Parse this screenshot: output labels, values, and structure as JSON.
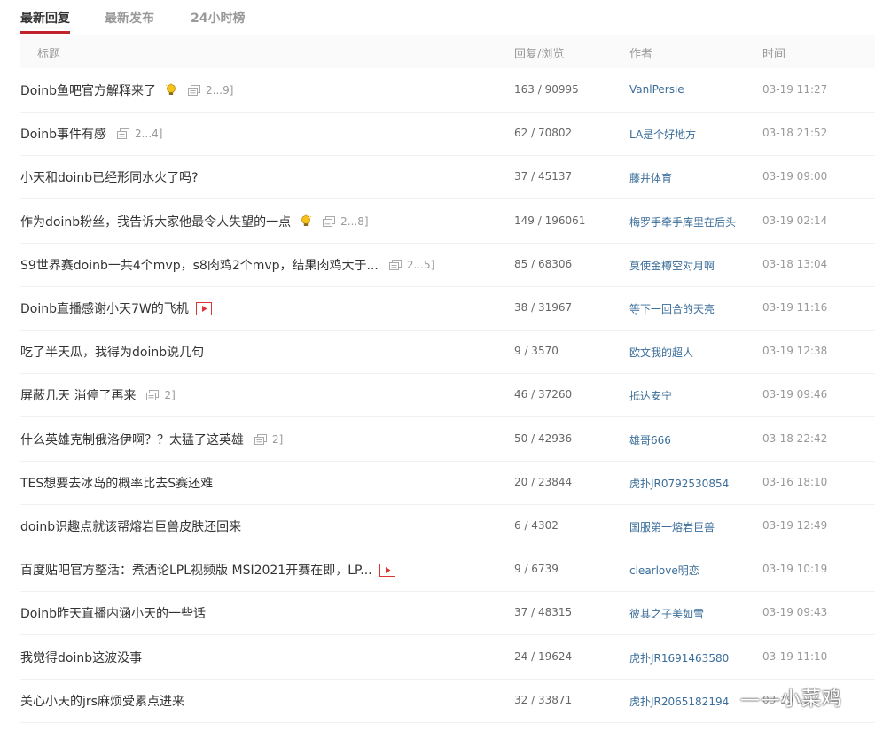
{
  "tabs": [
    {
      "label": "最新回复",
      "active": true
    },
    {
      "label": "最新发布",
      "active": false
    },
    {
      "label": "24小时榜",
      "active": false
    }
  ],
  "accent_color": "#c0232a",
  "author_color": "#3a6d99",
  "columns": {
    "title": "标题",
    "stats": "回复/浏览",
    "author": "作者",
    "time": "时间"
  },
  "rows": [
    {
      "title": "Doinb鱼吧官方解释来了",
      "lightbulb": true,
      "pages": "2...9]",
      "video": false,
      "stats": "163 / 90995",
      "author": "VanlPersie",
      "time": "03-19 11:27"
    },
    {
      "title": "Doinb事件有感",
      "lightbulb": false,
      "pages": "2...4]",
      "video": false,
      "stats": "62 / 70802",
      "author": "LA是个好地方",
      "time": "03-18 21:52"
    },
    {
      "title": "小天和doinb已经形同水火了吗?",
      "lightbulb": false,
      "pages": "",
      "video": false,
      "stats": "37 / 45137",
      "author": "藤井体育",
      "time": "03-19 09:00"
    },
    {
      "title": "作为doinb粉丝，我告诉大家他最令人失望的一点",
      "lightbulb": true,
      "pages": "2...8]",
      "video": false,
      "stats": "149 / 196061",
      "author": "梅罗手牵手库里在后头",
      "time": "03-19 02:14"
    },
    {
      "title": "S9世界赛doinb一共4个mvp，s8肉鸡2个mvp，结果肉鸡大于...",
      "lightbulb": false,
      "pages": "2...5]",
      "video": false,
      "stats": "85 / 68306",
      "author": "莫使金樽空对月啊",
      "time": "03-18 13:04"
    },
    {
      "title": "Doinb直播感谢小天7W的飞机",
      "lightbulb": false,
      "pages": "",
      "video": true,
      "stats": "38 / 31967",
      "author": "等下一回合的天亮",
      "time": "03-19 11:16"
    },
    {
      "title": "吃了半天瓜，我得为doinb说几句",
      "lightbulb": false,
      "pages": "",
      "video": false,
      "stats": "9 / 3570",
      "author": "欧文我的超人",
      "time": "03-19 12:38"
    },
    {
      "title": "屏蔽几天 消停了再来",
      "lightbulb": false,
      "pages": "2]",
      "video": false,
      "stats": "46 / 37260",
      "author": "抵达安宁",
      "time": "03-19 09:46"
    },
    {
      "title": "什么英雄克制俄洛伊啊？？太猛了这英雄",
      "lightbulb": false,
      "pages": "2]",
      "video": false,
      "stats": "50 / 42936",
      "author": "雄哥666",
      "time": "03-18 22:42"
    },
    {
      "title": "TES想要去冰岛的概率比去S赛还难",
      "lightbulb": false,
      "pages": "",
      "video": false,
      "stats": "20 / 23844",
      "author": "虎扑JR0792530854",
      "time": "03-16 18:10"
    },
    {
      "title": "doinb识趣点就该帮熔岩巨兽皮肤还回来",
      "lightbulb": false,
      "pages": "",
      "video": false,
      "stats": "6 / 4302",
      "author": "国服第一熔岩巨兽",
      "time": "03-19 12:49"
    },
    {
      "title": "百度贴吧官方整活：煮酒论LPL视频版 MSI2021开赛在即，LP...",
      "lightbulb": false,
      "pages": "",
      "video": true,
      "stats": "9 / 6739",
      "author": "clearlove明恋",
      "time": "03-19 10:19"
    },
    {
      "title": "Doinb昨天直播内涵小天的一些话",
      "lightbulb": false,
      "pages": "",
      "video": false,
      "stats": "37 / 48315",
      "author": "彼其之子美如雪",
      "time": "03-19 09:43"
    },
    {
      "title": "我觉得doinb这波没事",
      "lightbulb": false,
      "pages": "",
      "video": false,
      "stats": "24 / 19624",
      "author": "虎扑JR1691463580",
      "time": "03-19 11:10"
    },
    {
      "title": "关心小天的jrs麻烦受累点进来",
      "lightbulb": false,
      "pages": "",
      "video": false,
      "stats": "32 / 33871",
      "author": "虎扑JR2065182194",
      "time": "03-19 ..."
    }
  ],
  "watermark": "——小菜鸡"
}
